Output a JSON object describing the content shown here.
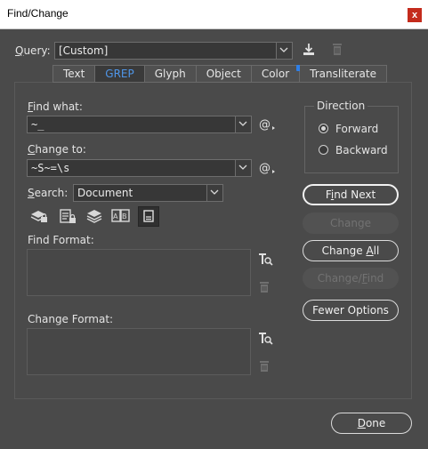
{
  "window": {
    "title": "Find/Change",
    "close_label": "x"
  },
  "query": {
    "label_char": "Q",
    "label_rest": "uery:",
    "value": "[Custom]"
  },
  "tabs": [
    {
      "label": "Text"
    },
    {
      "label": "GREP"
    },
    {
      "label": "Glyph"
    },
    {
      "label": "Object"
    },
    {
      "label": "Color"
    },
    {
      "label": "Transliterate"
    }
  ],
  "find_what": {
    "label_char": "F",
    "label_rest": "ind what:",
    "value": "~_"
  },
  "change_to": {
    "label_char": "C",
    "label_rest": "hange to:",
    "value": "~S~=\\s"
  },
  "search": {
    "label_char": "S",
    "label_rest": "earch:",
    "value": "Document"
  },
  "find_format": {
    "label": "Find Format:"
  },
  "change_format": {
    "label": "Change Format:"
  },
  "direction": {
    "label": "Direction",
    "options": [
      {
        "label": "Forward",
        "selected": true
      },
      {
        "label": "Backward",
        "selected": false
      }
    ]
  },
  "buttons": {
    "find_next": {
      "pre": "F",
      "char": "i",
      "post": "nd Next"
    },
    "change": {
      "label": "Change"
    },
    "change_all": {
      "pre": "Change ",
      "char": "A",
      "post": "ll"
    },
    "change_find": {
      "pre": "Change/",
      "char": "F",
      "post": "ind"
    },
    "fewer_options": {
      "label": "Fewer Options"
    },
    "done": {
      "pre": "",
      "char": "D",
      "post": "one"
    }
  },
  "colors": {
    "active_tab": "#4f96e8",
    "color_tab_dot": "#2e7fe8",
    "close_button": "#c42b1c"
  }
}
